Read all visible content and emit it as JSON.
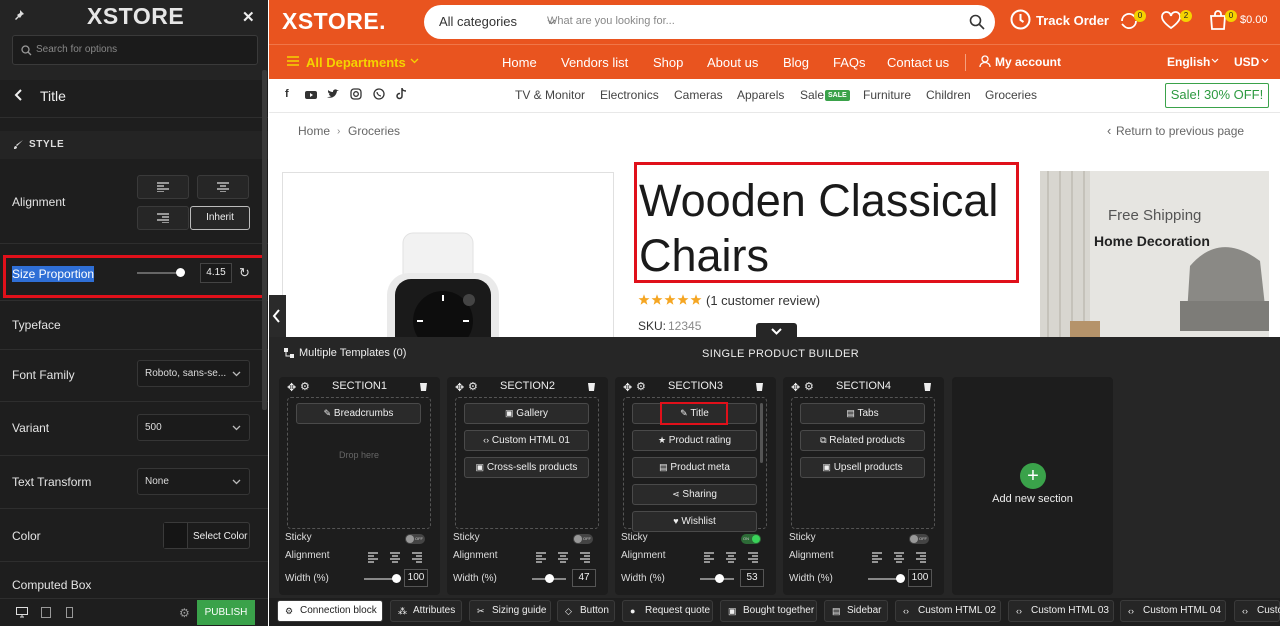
{
  "left_panel": {
    "logo": "XSTORE",
    "search_placeholder": "Search for options",
    "back_title": "Title",
    "style_header": "STYLE",
    "fields": {
      "alignment": "Alignment",
      "alignment_inherit": "Inherit",
      "size_proportion": "Size Proportion",
      "size_proportion_value": "4.15",
      "typeface": "Typeface",
      "font_family": "Font Family",
      "font_family_value": "Roboto, sans-se...",
      "variant": "Variant",
      "variant_value": "500",
      "text_transform": "Text Transform",
      "text_transform_value": "None",
      "color": "Color",
      "color_button": "Select Color",
      "computed_box": "Computed Box"
    },
    "publish_label": "PUBLISH"
  },
  "header": {
    "logo": "XSTORE.",
    "category_select": "All categories",
    "search_placeholder": "What are you looking for...",
    "track_order": "Track Order",
    "compare_count": "0",
    "wishlist_count": "2",
    "cart_count": "0",
    "cart_total": "$0.00",
    "departments": "All Departments",
    "nav": [
      "Home",
      "Vendors list",
      "Shop",
      "About us",
      "Blog",
      "FAQs",
      "Contact us"
    ],
    "my_account": "My account",
    "language": "English",
    "currency": "USD",
    "categories": [
      "TV & Monitor",
      "Electronics",
      "Cameras",
      "Apparels",
      "Sale",
      "Furniture",
      "Children",
      "Groceries"
    ],
    "sale_badge": "SALE",
    "sale_button": "Sale! 30% OFF!"
  },
  "breadcrumb": {
    "home": "Home",
    "current": "Groceries",
    "return": "Return to previous page"
  },
  "product": {
    "title": "Wooden Classical Chairs",
    "rating": 5,
    "review_text": "(1 customer review)",
    "sku_label": "SKU:",
    "sku_value": "12345"
  },
  "banner": {
    "line1": "Free Shipping",
    "line2": "Home Decoration"
  },
  "builder": {
    "multiple_templates": "Multiple Templates (0)",
    "title": "SINGLE PRODUCT BUILDER",
    "drop_here": "Drop here",
    "add_section": "Add new section",
    "sticky": "Sticky",
    "alignment": "Alignment",
    "width": "Width (%)",
    "toggle_off": "OFF",
    "toggle_on": "ON",
    "sections": [
      {
        "name": "SECTION1",
        "blocks": [
          "Breadcrumbs"
        ],
        "sticky": false,
        "width": "100",
        "width_frac": 1.0
      },
      {
        "name": "SECTION2",
        "blocks": [
          "Gallery",
          "Custom HTML 01",
          "Cross-sells products"
        ],
        "sticky": false,
        "width": "47",
        "width_frac": 0.47
      },
      {
        "name": "SECTION3",
        "blocks": [
          "Title",
          "Product rating",
          "Product meta",
          "Sharing",
          "Wishlist"
        ],
        "sticky": true,
        "width": "53",
        "width_frac": 0.53
      },
      {
        "name": "SECTION4",
        "blocks": [
          "Tabs",
          "Related products",
          "Upsell products"
        ],
        "sticky": false,
        "width": "100",
        "width_frac": 1.0
      }
    ]
  },
  "toolbar": [
    "Connection block",
    "Attributes",
    "Sizing guide",
    "Button",
    "Request quote",
    "Bought together",
    "Sidebar",
    "Custom HTML 02",
    "Custom HTML 03",
    "Custom HTML 04",
    "Custom"
  ],
  "colors": {
    "brand": "#e9541f",
    "highlight": "#e0101a",
    "publish": "#3aa24a"
  }
}
